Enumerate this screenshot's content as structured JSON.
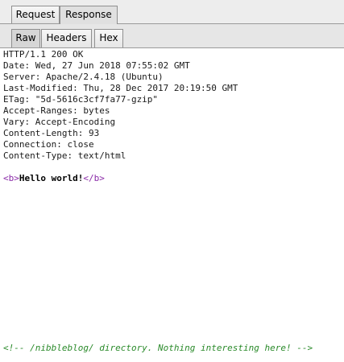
{
  "tabs": {
    "request": "Request",
    "response": "Response"
  },
  "subtabs": {
    "raw": "Raw",
    "headers": "Headers",
    "hex": "Hex"
  },
  "response": {
    "headers": [
      "HTTP/1.1 200 OK",
      "Date: Wed, 27 Jun 2018 07:55:02 GMT",
      "Server: Apache/2.4.18 (Ubuntu)",
      "Last-Modified: Thu, 28 Dec 2017 20:19:50 GMT",
      "ETag: \"5d-5616c3cf7fa77-gzip\"",
      "Accept-Ranges: bytes",
      "Vary: Accept-Encoding",
      "Content-Length: 93",
      "Connection: close",
      "Content-Type: text/html"
    ],
    "body": {
      "open_tag": "<b>",
      "text": "Hello world!",
      "close_tag": "</b>",
      "comment": "<!-- /nibbleblog/ directory. Nothing interesting here! -->"
    }
  },
  "colors": {
    "tag": "#8a2aa8",
    "comment": "#2a8a2a"
  }
}
